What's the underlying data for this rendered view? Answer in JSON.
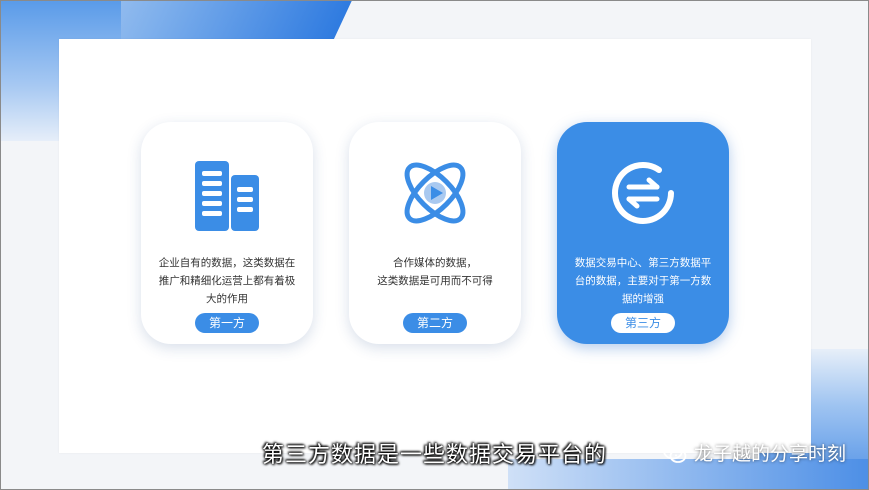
{
  "cards": [
    {
      "icon": "building-icon",
      "description": "企业自有的数据，这类数据在推广和精细化运营上都有着极大的作用",
      "tag": "第一方"
    },
    {
      "icon": "media-orbit-icon",
      "description": "合作媒体的数据，\n这类数据是可用而不可得",
      "tag": "第二方"
    },
    {
      "icon": "exchange-icon",
      "description": "数据交易中心、第三方数据平台的数据，主要对于第一方数据的增强",
      "tag": "第三方"
    }
  ],
  "subtitle": "第三方数据是一些数据交易平台的",
  "watermark": {
    "icon": "wechat-icon",
    "text": "龙子越的分享时刻"
  },
  "colors": {
    "accent": "#3b8de6",
    "card_bg": "#ffffff",
    "text": "#333333"
  }
}
